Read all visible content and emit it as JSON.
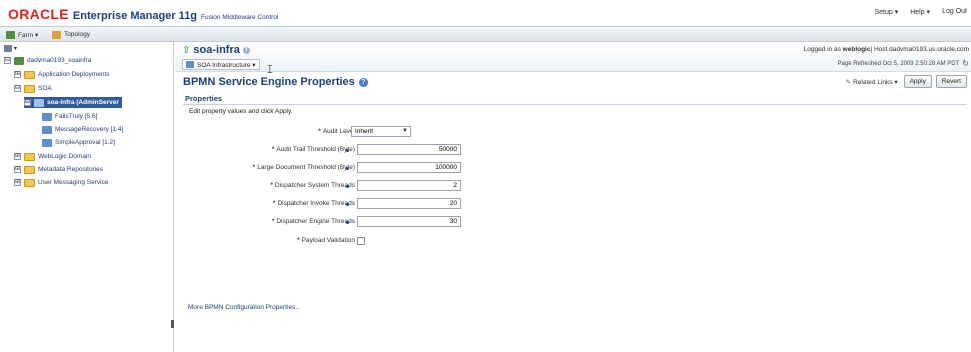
{
  "header": {
    "brand_oracle": "ORACLE",
    "product": "Enterprise Manager 11g",
    "subtitle": "Fusion Middleware Control",
    "links": [
      "Setup ▾",
      "Help ▾",
      "Log Out"
    ]
  },
  "toolbar": {
    "farm_label": "Farm ▾",
    "topology_label": "Topology"
  },
  "navigator": {
    "items": [
      {
        "label": "dadvma0193_soainfra",
        "expander": "⊟"
      },
      {
        "label": "Application Deployments",
        "expander": "⊞"
      },
      {
        "label": "SOA",
        "expander": "⊟"
      },
      {
        "label": "soa-infra (AdminServer",
        "expander": "⊟"
      },
      {
        "label": "FailsTruly [5.6]"
      },
      {
        "label": "MessageRecovery [1.4]"
      },
      {
        "label": "SimpleApproval [1.2]"
      },
      {
        "label": "WebLogic Domain",
        "expander": "⊞"
      },
      {
        "label": "Metadata Repositories",
        "expander": "⊞"
      },
      {
        "label": "User Messaging Service",
        "expander": "⊞"
      }
    ]
  },
  "target": {
    "name": "soa-infra",
    "menu_label": "SOA Infrastructure ▾",
    "login_prefix": "Logged in as",
    "login_user": "weblogic",
    "host_text": "| Host dadvma0193.us.oracle.com",
    "refreshed": "Page Refreshed Oct 5, 2009 2:50:28 AM PDT"
  },
  "page": {
    "title": "BPMN Service Engine Properties",
    "related_links": "Related Links ▾",
    "apply": "Apply",
    "revert": "Revert",
    "section": "Properties",
    "instructions": "Edit property values and click Apply.",
    "more_link": "More BPMN Configuration Properties..."
  },
  "properties": [
    {
      "label": "Audit Level",
      "type": "select",
      "value": "Inherit"
    },
    {
      "label": "Audit Trail Threshold (Byte)",
      "type": "text",
      "value": "50000"
    },
    {
      "label": "Large Document Threshold (Byte)",
      "type": "text",
      "value": "100000"
    },
    {
      "label": "Dispatcher System Threads",
      "type": "text",
      "value": "2"
    },
    {
      "label": "Dispatcher Invoke Threads",
      "type": "text",
      "value": "20"
    },
    {
      "label": "Dispatcher Engine Threads",
      "type": "text",
      "value": "30"
    },
    {
      "label": "Payload Validation",
      "type": "checkbox",
      "value": ""
    }
  ],
  "colors": {
    "oracle_red": "#e2231a",
    "brand_blue": "#1f3f80",
    "selected_bg": "#2e5d9f"
  }
}
